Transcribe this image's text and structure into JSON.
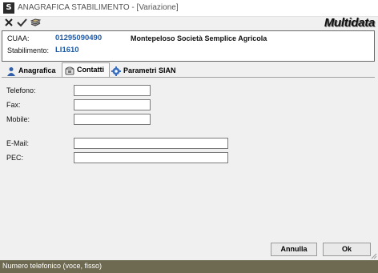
{
  "window": {
    "title": "ANAGRAFICA STABILIMENTO - [Variazione]",
    "app_icon_letter": "S"
  },
  "toolbar": {
    "buttons": [
      "close-x-icon",
      "check-icon",
      "stack-icon"
    ]
  },
  "logo": {
    "text": "Multidata"
  },
  "header": {
    "cuaa_label": "CUAA:",
    "cuaa_value": "01295090490",
    "company_name": "Montepeloso Società Semplice Agricola",
    "stabilimento_label": "Stabilimento:",
    "stabilimento_value": "LI1610"
  },
  "tabs": [
    {
      "label": "Anagrafica",
      "icon": "person-icon",
      "active": false
    },
    {
      "label": "Contatti",
      "icon": "phone-icon",
      "active": true
    },
    {
      "label": "Parametri SIAN",
      "icon": "gear-icon",
      "active": false
    }
  ],
  "fields": {
    "telefono": {
      "label": "Telefono:",
      "value": ""
    },
    "fax": {
      "label": "Fax:",
      "value": ""
    },
    "mobile": {
      "label": "Mobile:",
      "value": ""
    },
    "email": {
      "label": "E-Mail:",
      "value": ""
    },
    "pec": {
      "label": "PEC:",
      "value": ""
    }
  },
  "buttons": {
    "annulla": "Annulla",
    "ok": "Ok"
  },
  "status": {
    "text": "Numero telefonico (voce, fisso)"
  },
  "colors": {
    "status_bar": "#6e6a52",
    "code_blue": "#1f5aa6"
  }
}
